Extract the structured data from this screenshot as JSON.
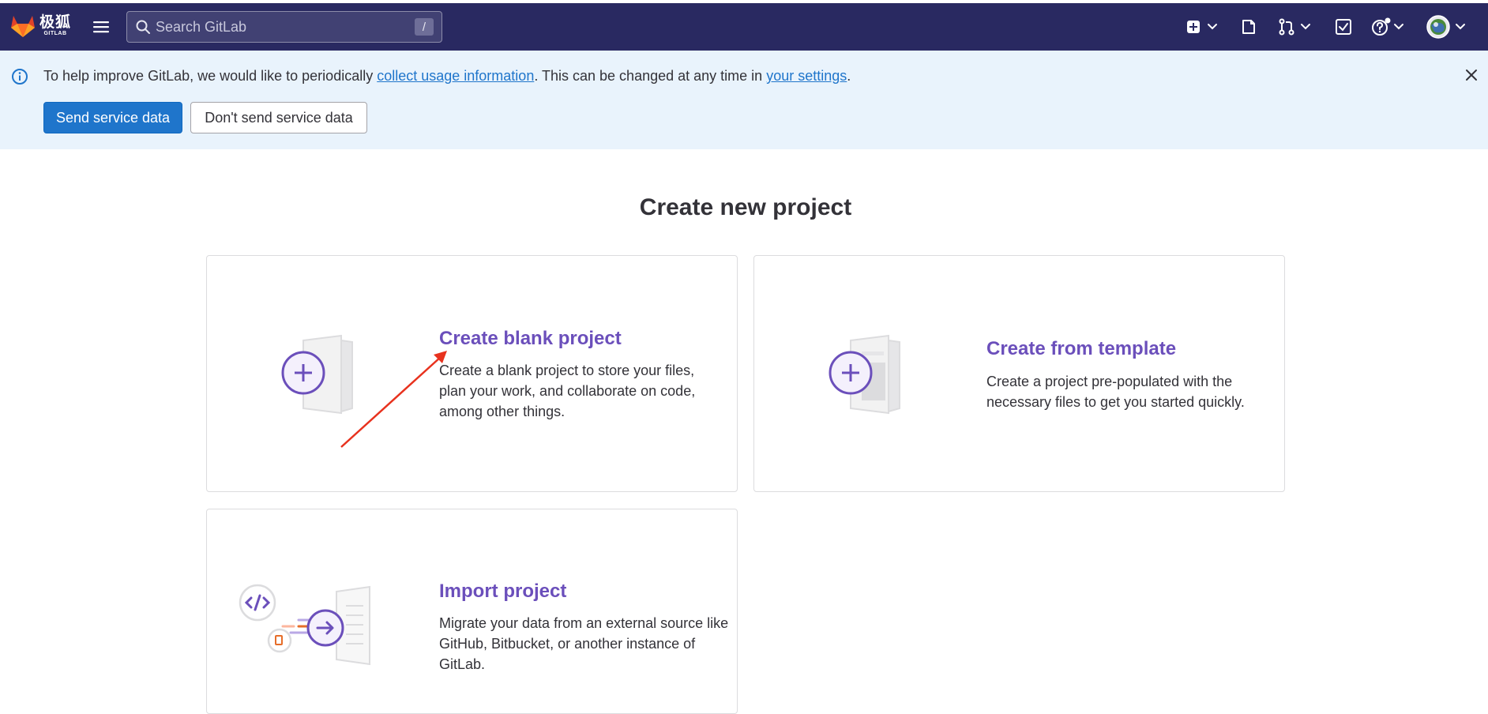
{
  "navbar": {
    "brand_zh": "极狐",
    "brand_en": "GITLAB",
    "search_placeholder": "Search GitLab",
    "search_shortcut": "/",
    "icons": [
      "menu-icon",
      "search-icon",
      "new-item-icon",
      "issues-icon",
      "merge-requests-icon",
      "todos-icon",
      "help-icon",
      "avatar"
    ]
  },
  "banner": {
    "text_before": "To help improve GitLab, we would like to periodically ",
    "link1": "collect usage information",
    "text_middle": ". This can be changed at any time in ",
    "link2": "your settings",
    "text_after": ".",
    "send_button": "Send service data",
    "dont_send_button": "Don't send service data"
  },
  "main": {
    "page_title": "Create new project",
    "cards": [
      {
        "title": "Create blank project",
        "description": "Create a blank project to store your files, plan your work, and collaborate on code, among other things."
      },
      {
        "title": "Create from template",
        "description": "Create a project pre-populated with the necessary files to get you started quickly."
      },
      {
        "title": "Import project",
        "description": "Migrate your data from an external source like GitHub, Bitbucket, or another instance of GitLab."
      }
    ]
  },
  "colors": {
    "navbar_bg": "#292961",
    "banner_bg": "#e9f3fc",
    "primary": "#1f75cb",
    "card_title": "#6b4fbb",
    "annotation_arrow": "#e8321e"
  }
}
